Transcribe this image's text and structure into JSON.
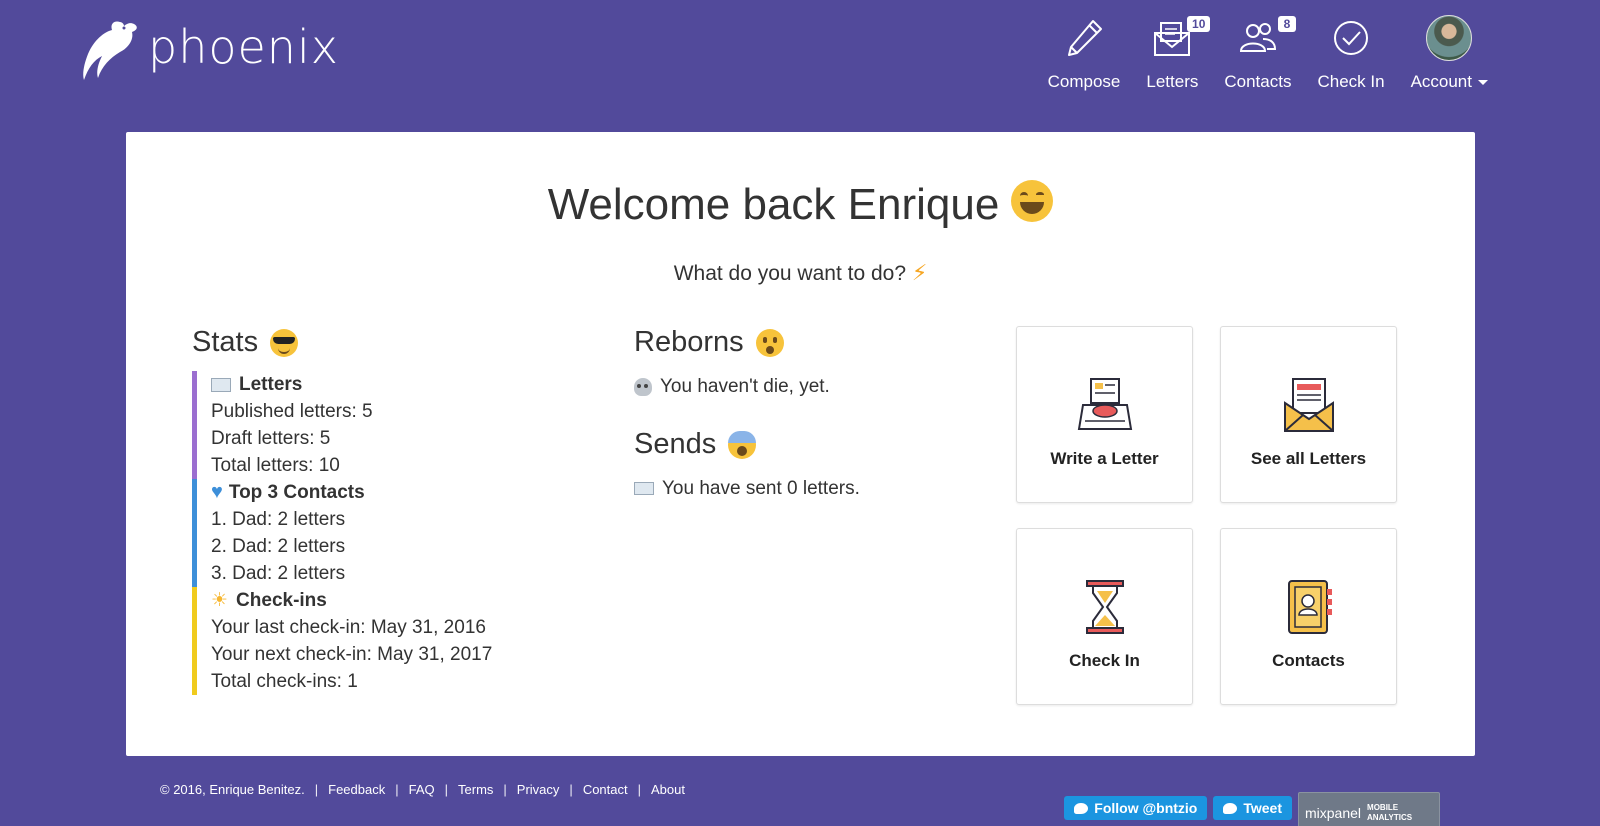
{
  "brand": {
    "name": "phoenix"
  },
  "nav": {
    "compose": {
      "label": "Compose"
    },
    "letters": {
      "label": "Letters",
      "badge": "10"
    },
    "contacts": {
      "label": "Contacts",
      "badge": "8"
    },
    "checkin": {
      "label": "Check In"
    },
    "account": {
      "label": "Account"
    }
  },
  "welcome": {
    "title": "Welcome back Enrique",
    "subtitle": "What do you want to do?"
  },
  "stats": {
    "title": "Stats",
    "letters": {
      "heading": "Letters",
      "lines": [
        "Published letters: 5",
        "Draft letters: 5",
        "Total letters: 10"
      ]
    },
    "contacts": {
      "heading": "Top 3 Contacts",
      "lines": [
        "1. Dad: 2 letters",
        "2. Dad: 2 letters",
        "3. Dad: 2 letters"
      ]
    },
    "checkins": {
      "heading": "Check-ins",
      "lines": [
        "Your last check-in: May 31, 2016",
        "Your next check-in: May 31, 2017",
        "Total check-ins: 1"
      ]
    }
  },
  "reborns": {
    "title": "Reborns",
    "text": "You haven't die, yet."
  },
  "sends": {
    "title": "Sends",
    "text": "You have sent 0 letters."
  },
  "tiles": {
    "write": "Write a Letter",
    "see_all": "See all Letters",
    "check_in": "Check In",
    "contacts": "Contacts"
  },
  "footer": {
    "copyright": "© 2016, Enrique Benitez.",
    "links": [
      "Feedback",
      "FAQ",
      "Terms",
      "Privacy",
      "Contact",
      "About"
    ],
    "follow": "Follow @bntzio",
    "tweet": "Tweet",
    "mixpanel": "mixpanel",
    "mixpanel_sub1": "MOBILE",
    "mixpanel_sub2": "ANALYTICS"
  },
  "colors": {
    "background": "#524a9b",
    "letters_bar": "#9b6ed0",
    "contacts_bar": "#3d8fd9",
    "checkins_bar": "#f0cb1d",
    "twitter": "#1b95e0"
  }
}
